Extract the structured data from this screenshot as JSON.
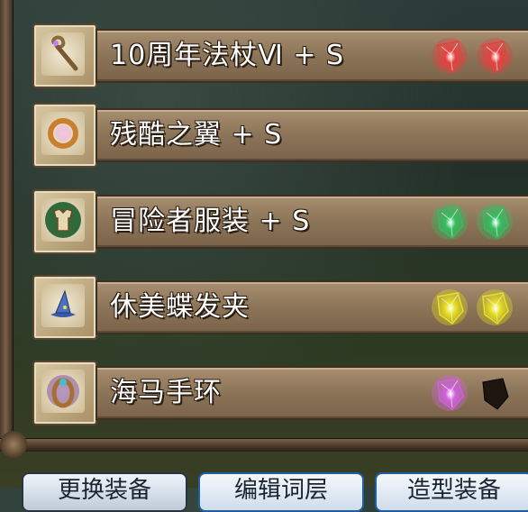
{
  "equipment": [
    {
      "name": "10周年法杖Ⅵ + S",
      "icon": "staff-icon",
      "gems": [
        "red",
        "red"
      ]
    },
    {
      "name": "残酷之翼 + S",
      "icon": "ring-icon",
      "gems": []
    },
    {
      "name": "冒险者服装 + S",
      "icon": "armor-icon",
      "gems": [
        "green",
        "green"
      ]
    },
    {
      "name": "休美蝶发夹",
      "icon": "hat-icon",
      "gems": [
        "yellow",
        "yellow"
      ]
    },
    {
      "name": "海马手环",
      "icon": "bracelet-icon",
      "gems": [
        "purple",
        "empty"
      ]
    }
  ],
  "gem_colors": {
    "red": "#e84040",
    "green": "#30c060",
    "yellow": "#e8e020",
    "purple": "#d060e0",
    "empty": "#2a2018"
  },
  "buttons": [
    {
      "label": "更换装备"
    },
    {
      "label": "编辑词层"
    },
    {
      "label": "造型装备"
    }
  ]
}
